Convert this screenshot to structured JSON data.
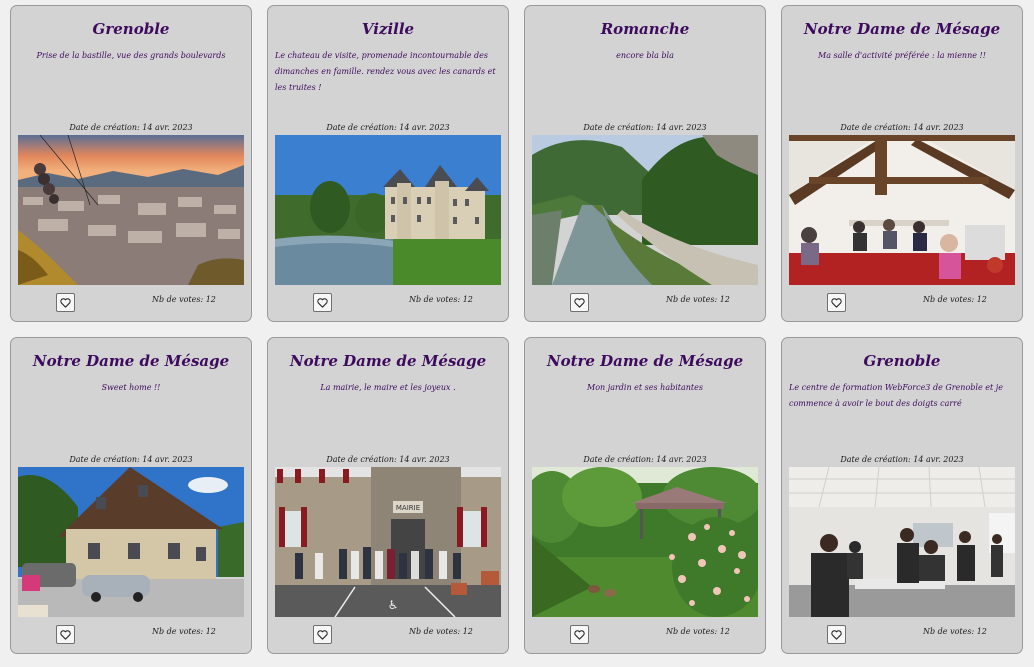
{
  "cards": [
    {
      "title": "Grenoble",
      "description": "Prise de la bastille, vue des grands boulevards",
      "date": "Date de création: 14 avr. 2023",
      "votes": "Nb de votes: 12",
      "image": "grenoble-bastille-cablecar-photo"
    },
    {
      "title": "Vizille",
      "description": "Le chateau de visite, promenade incontournable des dimanches en famille. rendez vous avec les canards et les truites !",
      "date": "Date de création: 14 avr. 2023",
      "votes": "Nb de votes: 12",
      "image": "vizille-castle-photo"
    },
    {
      "title": "Romanche",
      "description": "encore bla bla",
      "date": "Date de création: 14 avr. 2023",
      "votes": "Nb de votes: 12",
      "image": "romanche-river-photo"
    },
    {
      "title": "Notre Dame de Mésage",
      "description": "Ma salle d'activité préférée : la mienne !!",
      "date": "Date de création: 14 avr. 2023",
      "votes": "Nb de votes: 12",
      "image": "activity-room-photo"
    },
    {
      "title": "Notre Dame de Mésage",
      "description": "Sweet home !!",
      "date": "Date de création: 14 avr. 2023",
      "votes": "Nb de votes: 12",
      "image": "house-photo"
    },
    {
      "title": "Notre Dame de Mésage",
      "description": "La mairie, le maire et les joyeux .",
      "date": "Date de création: 14 avr. 2023",
      "votes": "Nb de votes: 12",
      "image": "town-hall-photo"
    },
    {
      "title": "Notre Dame de Mésage",
      "description": "Mon jardin et ses habitantes",
      "date": "Date de création: 14 avr. 2023",
      "votes": "Nb de votes: 12",
      "image": "garden-photo"
    },
    {
      "title": "Grenoble",
      "description": "Le centre de formation WebForce3 de Grenoble et je commence à avoir le bout des doigts carré",
      "date": "Date de création: 14 avr. 2023",
      "votes": "Nb de votes: 12",
      "image": "training-room-photo"
    }
  ],
  "like_icon": "heart-outline-icon",
  "colors": {
    "title": "#3d0a5e",
    "card_bg": "#d3d3d3",
    "page_bg": "#f0f0f0"
  }
}
